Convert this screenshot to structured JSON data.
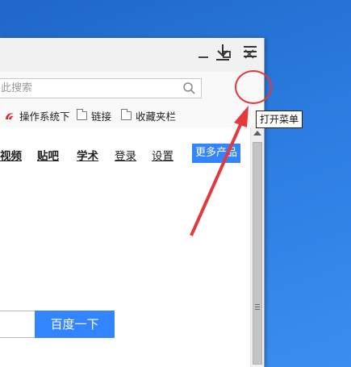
{
  "window": {
    "minimize_icon": "minimize-icon",
    "maximize_icon": "maximize-icon",
    "close_icon": "close-icon"
  },
  "address_bar": {
    "placeholder": "此搜索"
  },
  "toolbar": {
    "download_icon": "download-icon",
    "menu_icon": "hamburger-menu-icon"
  },
  "bookmarks": {
    "items": [
      {
        "label": "操作系统下",
        "icon": "red-swirl-icon"
      },
      {
        "label": "链接",
        "icon": "folder-icon"
      },
      {
        "label": "收藏夹栏",
        "icon": "folder-icon"
      }
    ],
    "more": "»"
  },
  "page": {
    "nav": [
      "视频",
      "贴吧",
      "学术",
      "登录",
      "设置"
    ],
    "more_products": "更多产品",
    "search_button": "百度一下"
  },
  "annotation": {
    "tooltip": "打开菜单",
    "color": "#e4383a"
  }
}
